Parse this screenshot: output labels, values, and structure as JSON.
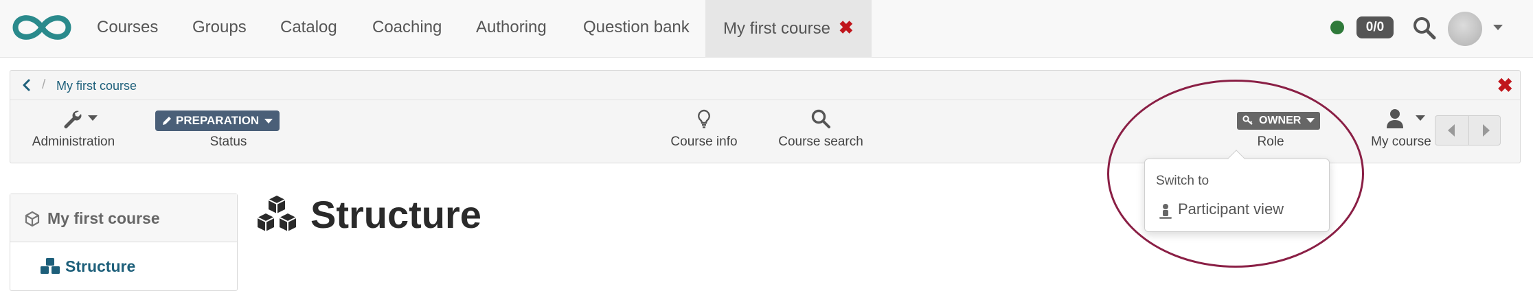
{
  "topnav": {
    "items": [
      "Courses",
      "Groups",
      "Catalog",
      "Coaching",
      "Authoring",
      "Question bank"
    ],
    "active_tab": {
      "label": "My first course"
    },
    "score": "0/0"
  },
  "breadcrumb": {
    "current": "My first course"
  },
  "toolbar": {
    "administration": "Administration",
    "status_badge": "PREPARATION",
    "status_label": "Status",
    "course_info": "Course info",
    "course_search": "Course search",
    "role_badge": "OWNER",
    "role_label": "Role",
    "my_course": "My course"
  },
  "role_menu": {
    "header": "Switch to",
    "items": [
      {
        "label": "Participant view"
      }
    ]
  },
  "course_menu": {
    "root": "My first course",
    "children": [
      {
        "label": "Structure"
      }
    ]
  },
  "main": {
    "title": "Structure"
  },
  "colors": {
    "brand": "#1f7a7a",
    "link": "#1d5f7a",
    "close": "#c0161c",
    "status_badge": "#4a5f78",
    "highlight": "#8a1f45",
    "online": "#2f7a3a"
  }
}
